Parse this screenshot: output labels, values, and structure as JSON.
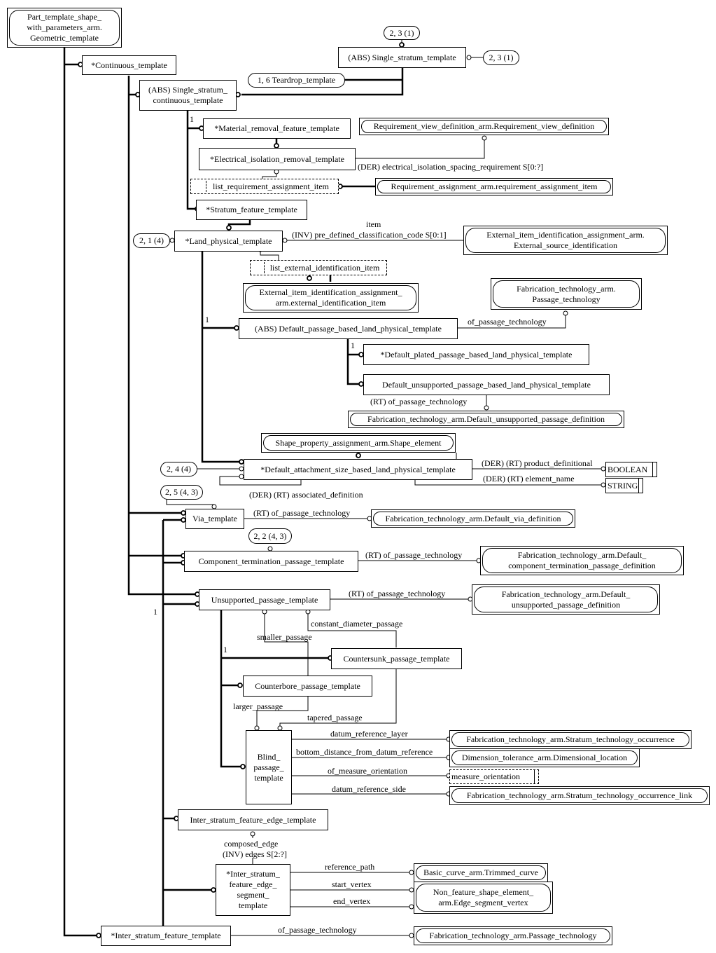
{
  "diagram": {
    "root": {
      "text": "Part_template_shape_\nwith_parameters_arm.\nGeometric_template"
    },
    "entities": {
      "continuous_template": "*Continuous_template",
      "single_stratum_template": "(ABS) Single_stratum_template",
      "single_stratum_continuous_template": "(ABS) Single_stratum_\ncontinuous_template",
      "material_removal_feature_template": "*Material_removal_feature_template",
      "electrical_isolation_removal_template": "*Electrical_isolation_removal_template",
      "stratum_feature_template": "*Stratum_feature_template",
      "land_physical_template": "*Land_physical_template",
      "default_passage_based_land_physical_template": "(ABS) Default_passage_based_land_physical_template",
      "default_plated_passage_based_land_physical_template": "*Default_plated_passage_based_land_physical_template",
      "default_unsupported_passage_based_land_physical_template": "Default_unsupported_passage_based_land_physical_template",
      "default_attachment_size_based_land_physical_template": "*Default_attachment_size_based_land_physical_template",
      "via_template": "Via_template",
      "component_termination_passage_template": "Component_termination_passage_template",
      "unsupported_passage_template": "Unsupported_passage_template",
      "countersunk_passage_template": "Countersunk_passage_template",
      "counterbore_passage_template": "Counterbore_passage_template",
      "blind_passage_template": "Blind_\npassage_\ntemplate",
      "inter_stratum_feature_edge_template": "Inter_stratum_feature_edge_template",
      "inter_stratum_feature_edge_segment_template": "*Inter_stratum_\nfeature_edge_\nsegment_\ntemplate",
      "inter_stratum_feature_template": "*Inter_stratum_feature_template"
    },
    "selects": {
      "list_requirement_assignment_item": "list_requirement_assignment_item",
      "list_external_identification_item": "list_external_identification_item",
      "measure_orientation": "measure_orientation"
    },
    "types": {
      "boolean": "BOOLEAN",
      "string": "STRING"
    },
    "external": {
      "requirement_view_definition": "Requirement_view_definition_arm.Requirement_view_definition",
      "requirement_assignment_item": "Requirement_assignment_arm.requirement_assignment_item",
      "external_source_identification": "External_item_identification_assignment_arm.\nExternal_source_identification",
      "external_identification_item": "External_item_identification_assignment_\narm.external_identification_item",
      "passage_technology_top": "Fabrication_technology_arm.\nPassage_technology",
      "default_unsupported_passage_definition_1": "Fabrication_technology_arm.Default_unsupported_passage_definition",
      "shape_element": "Shape_property_assignment_arm.Shape_element",
      "default_via_definition": "Fabrication_technology_arm.Default_via_definition",
      "default_component_termination_passage_definition": "Fabrication_technology_arm.Default_\ncomponent_termination_passage_definition",
      "default_unsupported_passage_definition_2": "Fabrication_technology_arm.Default_\nunsupported_passage_definition",
      "stratum_technology_occurrence": "Fabrication_technology_arm.Stratum_technology_occurrence",
      "dimensional_location": "Dimension_tolerance_arm.Dimensional_location",
      "stratum_technology_occurrence_link": "Fabrication_technology_arm.Stratum_technology_occurrence_link",
      "trimmed_curve": "Basic_curve_arm.Trimmed_curve",
      "edge_segment_vertex": "Non_feature_shape_element_\narm.Edge_segment_vertex",
      "passage_technology_bottom": "Fabrication_technology_arm.Passage_technology"
    },
    "page_refs": {
      "ref_23_1_top": "2, 3 (1)",
      "ref_23_1_right": "2, 3 (1)",
      "ref_16_teardrop": "1, 6 Teardrop_template",
      "ref_21_4": "2, 1 (4)",
      "ref_24_4": "2, 4 (4)",
      "ref_25_43": "2, 5 (4, 3)",
      "ref_22_43": "2, 2 (4, 3)"
    },
    "attributes": {
      "electrical_isolation_spacing_requirement": "(DER) electrical_isolation_spacing_requirement S[0:?]",
      "item": "item",
      "pre_defined_classification_code": "(INV) pre_defined_classification_code S[0:1]",
      "of_passage_technology_1": "of_passage_technology",
      "rt_of_passage_technology_1": "(RT) of_passage_technology",
      "product_definitional": "(DER) (RT) product_definitional",
      "element_name": "(DER) (RT) element_name",
      "associated_definition": "(DER) (RT) associated_definition",
      "rt_of_passage_technology_via": "(RT) of_passage_technology",
      "rt_of_passage_technology_comp": "(RT) of_passage_technology",
      "rt_of_passage_technology_unsup": "(RT) of_passage_technology",
      "constant_diameter_passage": "constant_diameter_passage",
      "smaller_passage": "smaller_passage",
      "larger_passage": "larger_passage",
      "tapered_passage": "tapered_passage",
      "datum_reference_layer": "datum_reference_layer",
      "bottom_distance_from_datum_reference": "bottom_distance_from_datum_reference",
      "of_measure_orientation": "of_measure_orientation",
      "datum_reference_side": "datum_reference_side",
      "composed_edge": "composed_edge",
      "inv_edges": "(INV) edges S[2:?]",
      "reference_path": "reference_path",
      "start_vertex": "start_vertex",
      "end_vertex": "end_vertex",
      "of_passage_technology_bottom": "of_passage_technology"
    },
    "cardinalities": {
      "one_a": "1",
      "one_b": "1",
      "one_c": "1",
      "one_d": "1",
      "one_e": "1"
    }
  }
}
